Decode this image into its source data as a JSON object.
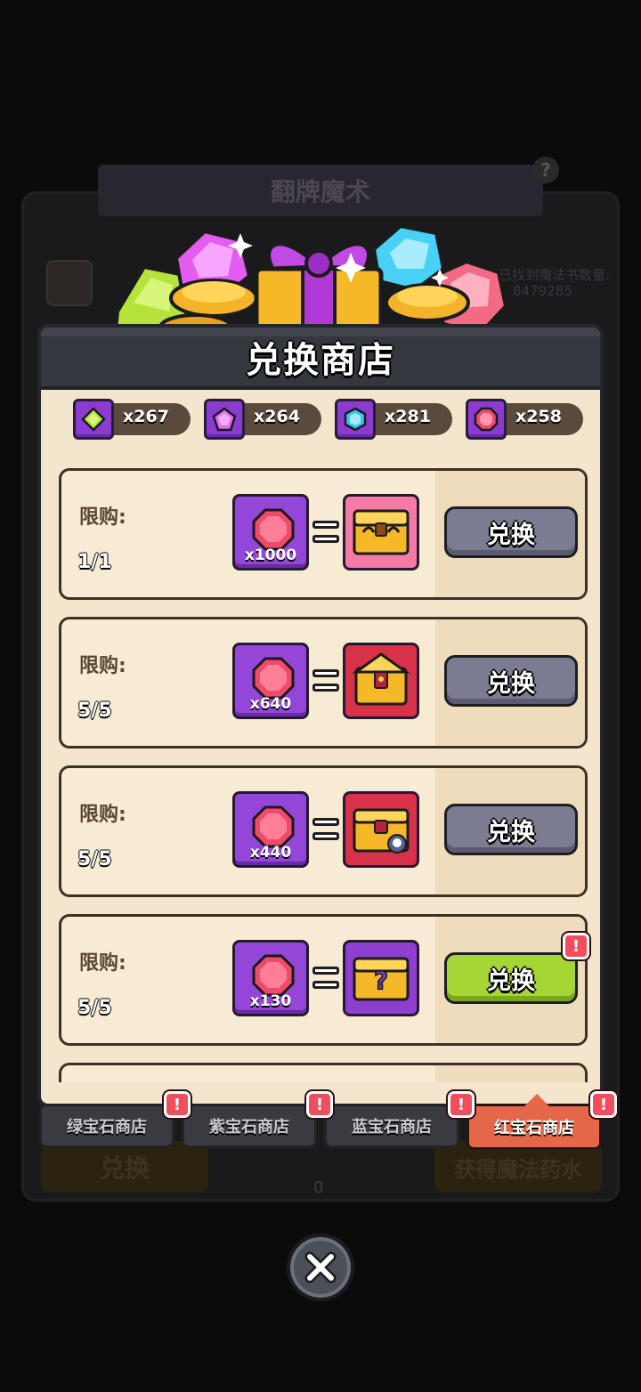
{
  "background": {
    "banner_title": "翻牌魔术",
    "help_label": "?",
    "found_books_label": "已找到魔法书数量:",
    "found_books_value": "8479285",
    "bottom_buttons": [
      "兑换",
      "获得魔法药水"
    ],
    "bottom_counter": "0"
  },
  "modal": {
    "title": "兑换商店"
  },
  "currencies": [
    {
      "name": "green-gem",
      "count": "x267",
      "color": "#b7e23c"
    },
    {
      "name": "purple-gem",
      "count": "x264",
      "color": "#d94ce8"
    },
    {
      "name": "blue-gem",
      "count": "x281",
      "color": "#35c4f2"
    },
    {
      "name": "red-gem",
      "count": "x258",
      "color": "#f04a6a"
    }
  ],
  "items": [
    {
      "limit_label": "限购:",
      "limit": "1/1",
      "cost": "x1000",
      "reward": "pink-gold-chest",
      "button": "兑换",
      "button_state": "grey",
      "badge": false
    },
    {
      "limit_label": "限购:",
      "limit": "5/5",
      "cost": "x640",
      "reward": "red-gold-chest",
      "button": "兑换",
      "button_state": "grey",
      "badge": false
    },
    {
      "limit_label": "限购:",
      "limit": "5/5",
      "cost": "x440",
      "reward": "red-skull-chest",
      "button": "兑换",
      "button_state": "grey",
      "badge": false
    },
    {
      "limit_label": "限购:",
      "limit": "5/5",
      "cost": "x130",
      "reward": "mystery-chest",
      "button": "兑换",
      "button_state": "green",
      "badge": true
    }
  ],
  "badge_text": "!",
  "tabs": [
    {
      "label": "绿宝石商店",
      "active": false,
      "badge": true
    },
    {
      "label": "紫宝石商店",
      "active": false,
      "badge": true
    },
    {
      "label": "蓝宝石商店",
      "active": false,
      "badge": true
    },
    {
      "label": "红宝石商店",
      "active": true,
      "badge": true
    }
  ]
}
